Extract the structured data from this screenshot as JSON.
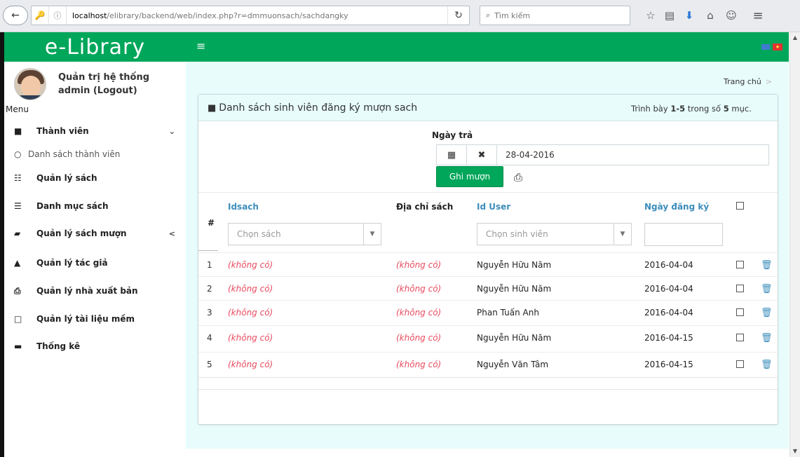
{
  "browser": {
    "url_host": "localhost",
    "url_path": "/elibrary/backend/web/index.php?r=dmmuonsach/sachdangky",
    "search_placeholder": "Tìm kiếm"
  },
  "app": {
    "logo": "e-Library"
  },
  "user": {
    "name": "Quản trị hệ thống",
    "account": "admin (Logout)"
  },
  "sidebar": {
    "menu_header": "Menu",
    "items": [
      {
        "label": "Thành viên",
        "icon": "user-icon"
      },
      {
        "label": "Danh sách thành viên",
        "icon": "circle-icon"
      },
      {
        "label": "Quản lý sách",
        "icon": "list-icon"
      },
      {
        "label": "Danh mục sách",
        "icon": "bars-icon"
      },
      {
        "label": "Quản lý sách mượn",
        "icon": "book-icon"
      },
      {
        "label": "Quản lý tác giả",
        "icon": "user-secret-icon"
      },
      {
        "label": "Quản lý nhà xuất bản",
        "icon": "print-icon"
      },
      {
        "label": "Quản lý tài liệu mềm",
        "icon": "file-pdf-icon"
      },
      {
        "label": "Thống kê",
        "icon": "table-icon"
      }
    ]
  },
  "breadcrumb": {
    "home": "Trang chủ",
    "sep": ">"
  },
  "panel": {
    "title": "Danh sách sinh viên đăng ký mượn sach",
    "summary_prefix": "Trình bày ",
    "summary_range": "1-5",
    "summary_mid": " trong số ",
    "summary_count": "5",
    "summary_suffix": " mục."
  },
  "form": {
    "date_label": "Ngày trả",
    "date_value": "28-04-2016",
    "save_button": "Ghi mượn"
  },
  "table": {
    "headers": {
      "index": "#",
      "idsach": "Idsach",
      "address": "Địa chỉ sách",
      "iduser": "Id User",
      "regdate": "Ngày đăng ký"
    },
    "filters": {
      "book_placeholder": "Chọn sách",
      "student_placeholder": "Chọn sinh viên"
    },
    "rows": [
      {
        "index": "1",
        "idsach": "(không có)",
        "address": "(không có)",
        "user": "Nguyễn Hữu Năm",
        "date": "2016-04-04"
      },
      {
        "index": "2",
        "idsach": "(không có)",
        "address": "(không có)",
        "user": "Nguyễn Hữu Năm",
        "date": "2016-04-04"
      },
      {
        "index": "3",
        "idsach": "(không có)",
        "address": "(không có)",
        "user": "Phan Tuấn Anh",
        "date": "2016-04-04"
      },
      {
        "index": "4",
        "idsach": "(không có)",
        "address": "(không có)",
        "user": "Nguyễn Hữu Năm",
        "date": "2016-04-15"
      },
      {
        "index": "5",
        "idsach": "(không có)",
        "address": "(không có)",
        "user": "Nguyễn Văn Tâm",
        "date": "2016-04-15"
      }
    ]
  },
  "colors": {
    "brand": "#00a65a",
    "link": "#3c8dbc",
    "empty": "#e84a5f",
    "content_bg": "#e8fcfc"
  }
}
